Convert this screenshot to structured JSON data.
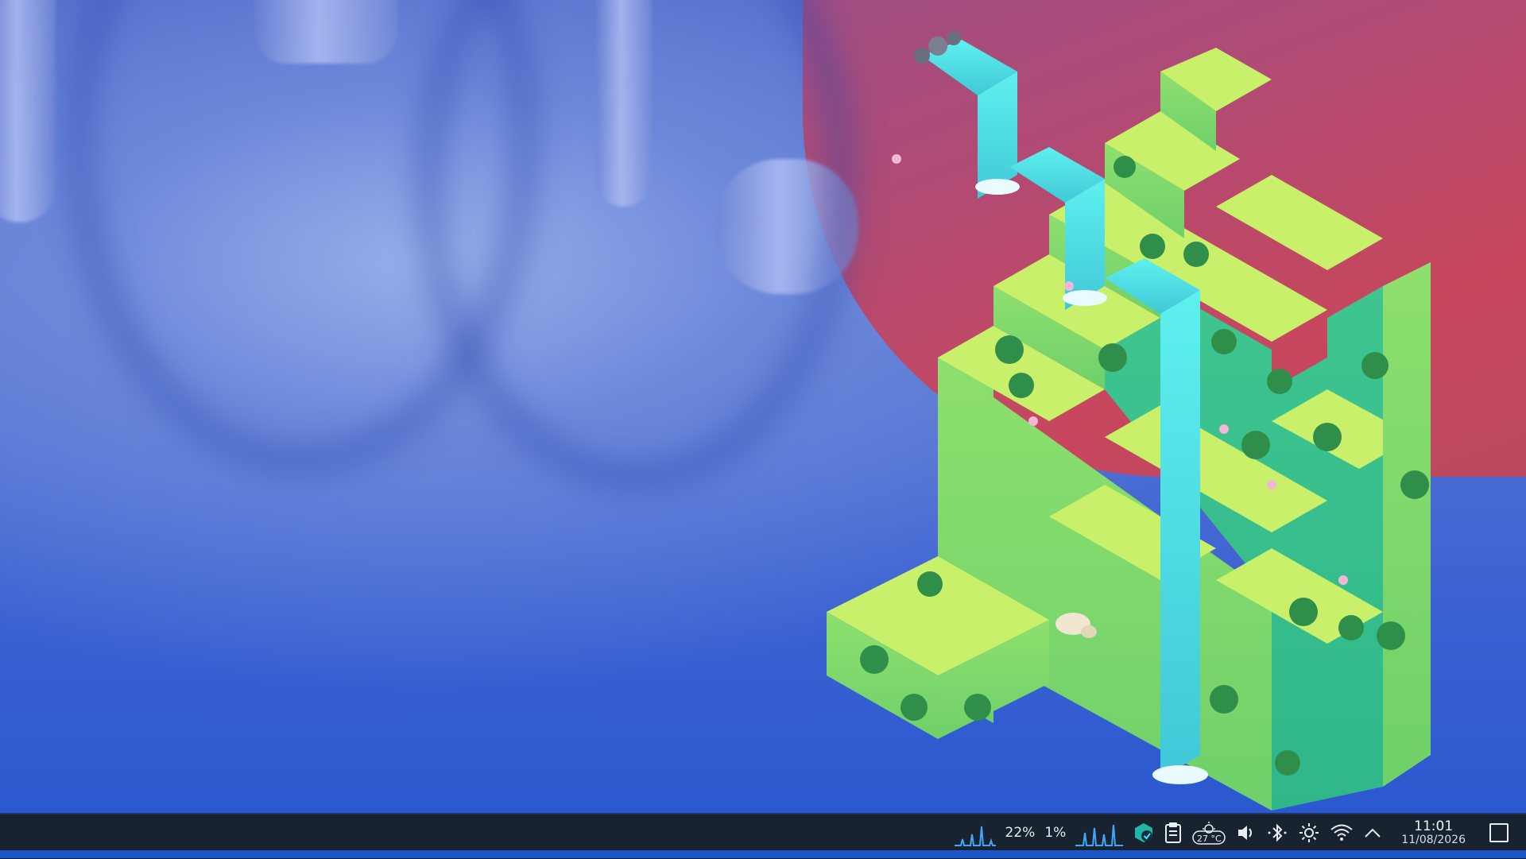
{
  "wallpaper": {
    "colors": {
      "blue_base": "#3f64d2",
      "blue_light": "#9bb2eb",
      "pink": "#c7475d",
      "grass_top": "#c8f06a",
      "grass_side": "#7ed86a",
      "grass_dark": "#3fbf8a",
      "water": "#5ee6e6"
    }
  },
  "taskbar": {
    "background": "#18232f",
    "system_monitor": {
      "cpu_percent": "22%",
      "memory_percent": "1%"
    },
    "weather": {
      "temperature": "27 °C"
    },
    "clock": {
      "time": "11:01",
      "date": "11/08/2026"
    },
    "icons": {
      "cpu_graph": "cpu-graph-icon",
      "network_graph": "network-graph-icon",
      "update": "update-check-icon",
      "clipboard": "clipboard-icon",
      "weather": "weather-icon",
      "volume": "volume-icon",
      "bluetooth": "bluetooth-icon",
      "brightness": "brightness-icon",
      "wifi": "wifi-icon",
      "tray_expand": "chevron-up-icon",
      "show_desktop": "show-desktop-icon"
    }
  }
}
